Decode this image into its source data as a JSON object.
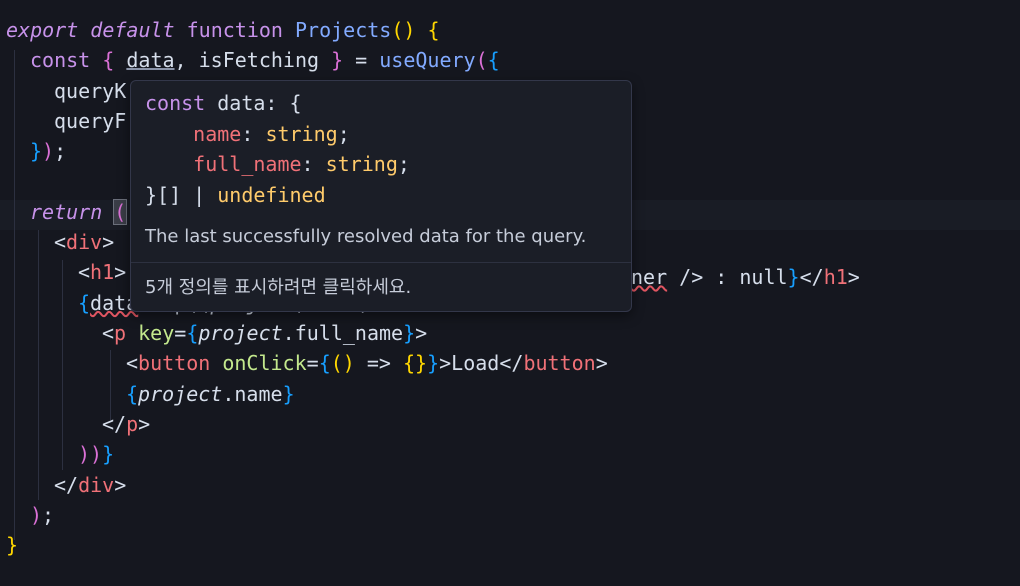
{
  "editor": {
    "lines": [
      {
        "segments": [
          [
            "export",
            "kw"
          ],
          [
            " ",
            "punct"
          ],
          [
            "default",
            "kw"
          ],
          [
            " ",
            "punct"
          ],
          [
            "function",
            "kw-plain"
          ],
          [
            " ",
            "punct"
          ],
          [
            "Projects",
            "fn"
          ],
          [
            "()",
            "br1"
          ],
          [
            " ",
            "punct"
          ],
          [
            "{",
            "br1"
          ]
        ]
      },
      {
        "segments": [
          [
            "const",
            "kw-plain"
          ],
          [
            " ",
            "punct"
          ],
          [
            "{",
            "br2"
          ],
          [
            " ",
            "punct"
          ],
          [
            "data",
            "ident underline"
          ],
          [
            ", isFetching ",
            "ident"
          ],
          [
            "}",
            "br2"
          ],
          [
            " = ",
            "punct"
          ],
          [
            "useQuery",
            "fn"
          ],
          [
            "(",
            "br2"
          ],
          [
            "{",
            "br3"
          ]
        ]
      },
      {
        "segments": [
          [
            "queryK",
            "ident"
          ]
        ]
      },
      {
        "segments": [
          [
            "queryF",
            "ident"
          ]
        ]
      },
      {
        "segments": [
          [
            "}",
            "br3"
          ],
          [
            ")",
            "br2"
          ],
          [
            ";",
            "punct"
          ]
        ]
      },
      {
        "segments": []
      },
      {
        "segments": [
          [
            "return",
            "kw"
          ],
          [
            " ",
            "punct"
          ],
          [
            "(",
            "br2 sel"
          ]
        ]
      },
      {
        "segments": [
          [
            "<",
            "punct"
          ],
          [
            "div",
            "tag"
          ],
          [
            ">",
            "punct"
          ]
        ]
      },
      {
        "segments": [
          [
            "<",
            "punct"
          ],
          [
            "h1",
            "tag"
          ],
          [
            ">",
            "punct"
          ]
        ]
      },
      {
        "segments": [
          [
            "{",
            "br3"
          ],
          [
            "data",
            "ident squiggle"
          ],
          [
            ".map((",
            "ident"
          ],
          [
            "project",
            "ital"
          ],
          [
            ") => (",
            "ident"
          ]
        ]
      },
      {
        "segments": [
          [
            "<",
            "punct"
          ],
          [
            "p",
            "tag"
          ],
          [
            " ",
            "punct"
          ],
          [
            "key",
            "prop"
          ],
          [
            "=",
            "punct"
          ],
          [
            "{",
            "br3"
          ],
          [
            "project",
            "ital"
          ],
          [
            ".full_name",
            "ident"
          ],
          [
            "}",
            "br3"
          ],
          [
            ">",
            "punct"
          ]
        ]
      },
      {
        "segments": [
          [
            "<",
            "punct"
          ],
          [
            "button",
            "tag"
          ],
          [
            " ",
            "punct"
          ],
          [
            "onClick",
            "prop"
          ],
          [
            "=",
            "punct"
          ],
          [
            "{",
            "br3"
          ],
          [
            "()",
            "br1"
          ],
          [
            " => ",
            "punct"
          ],
          [
            "{}",
            "br1"
          ],
          [
            "}",
            "br3"
          ],
          [
            ">Load</",
            "punct"
          ],
          [
            "button",
            "tag"
          ],
          [
            ">",
            "punct"
          ]
        ]
      },
      {
        "segments": [
          [
            "{",
            "br3"
          ],
          [
            "project",
            "ital"
          ],
          [
            ".name",
            "ident"
          ],
          [
            "}",
            "br3"
          ]
        ]
      },
      {
        "segments": [
          [
            "</",
            "punct"
          ],
          [
            "p",
            "tag"
          ],
          [
            ">",
            "punct"
          ]
        ]
      },
      {
        "segments": [
          [
            "))",
            "br2"
          ],
          [
            "}",
            "br3"
          ]
        ]
      },
      {
        "segments": [
          [
            "</",
            "punct"
          ],
          [
            "div",
            "tag"
          ],
          [
            ">",
            "punct"
          ]
        ]
      },
      {
        "segments": [
          [
            ")",
            "br2"
          ],
          [
            ";",
            "punct"
          ]
        ]
      },
      {
        "segments": [
          [
            "}",
            "br1"
          ]
        ]
      }
    ],
    "h1_tail": [
      [
        "ner",
        "ident squiggle"
      ],
      [
        " /> : null",
        "punct"
      ],
      [
        "}",
        "br3"
      ],
      [
        "</",
        "punct"
      ],
      [
        "h1",
        "tag"
      ],
      [
        ">",
        "punct"
      ]
    ]
  },
  "hover": {
    "code_lines": [
      [
        [
          "const",
          "kw-plain"
        ],
        [
          " data: {",
          "hv-type"
        ]
      ],
      [
        [
          "    ",
          "hv-type"
        ],
        [
          "name",
          "hv-prop"
        ],
        [
          ": ",
          "hv-type"
        ],
        [
          "string",
          "hv-str"
        ],
        [
          ";",
          "hv-type"
        ]
      ],
      [
        [
          "    ",
          "hv-type"
        ],
        [
          "full_name",
          "hv-prop"
        ],
        [
          ": ",
          "hv-type"
        ],
        [
          "string",
          "hv-str"
        ],
        [
          ";",
          "hv-type"
        ]
      ],
      [
        [
          "}[] | ",
          "hv-type"
        ],
        [
          "undefined",
          "hv-undef"
        ]
      ]
    ],
    "description": "The last successfully resolved data for the query.",
    "footer_link": "5개 정의를 표시하려면 클릭하세요."
  }
}
